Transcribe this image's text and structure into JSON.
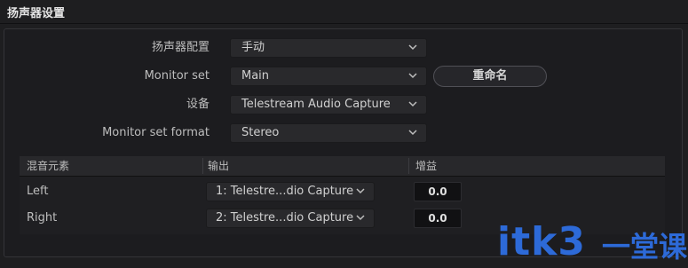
{
  "header": {
    "title": "扬声器设置"
  },
  "settings": {
    "speaker_config": {
      "label": "扬声器配置",
      "value": "手动"
    },
    "monitor_set": {
      "label": "Monitor set",
      "value": "Main",
      "rename_label": "重命名"
    },
    "device": {
      "label": "设备",
      "value": "Telestream Audio Capture"
    },
    "monitor_set_format": {
      "label": "Monitor set format",
      "value": "Stereo"
    }
  },
  "mix_table": {
    "columns": [
      "混音元素",
      "输出",
      "增益"
    ],
    "rows": [
      {
        "name": "Left",
        "output": "1: Telestre...dio Capture",
        "gain": "0.0"
      },
      {
        "name": "Right",
        "output": "2: Telestre...dio Capture",
        "gain": "0.0"
      }
    ]
  },
  "watermark": {
    "latin": "itk3",
    "cn": "一堂课"
  },
  "colors": {
    "background": "#1e1e20",
    "control": "#29292c",
    "watermark": "#2d6ad8"
  },
  "icons": {
    "dropdown": "chevron-down-icon"
  }
}
